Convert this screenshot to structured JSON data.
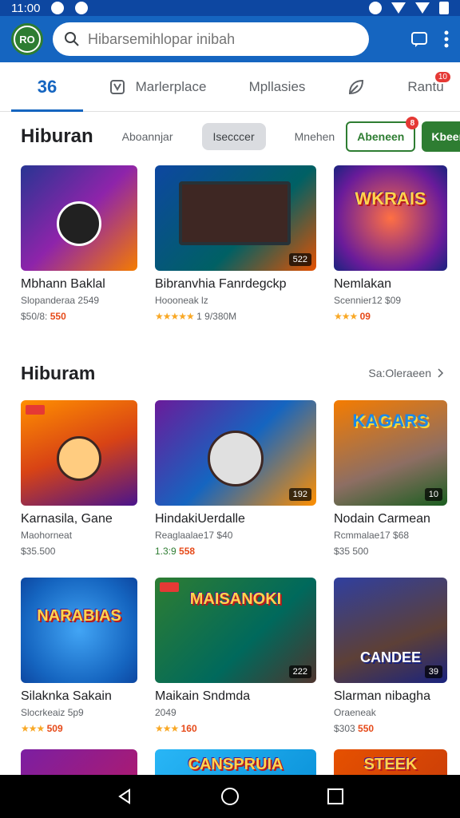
{
  "status_bar": {
    "time": "11:00"
  },
  "app_bar": {
    "logo_text": "RO",
    "search_placeholder": "Hibarsemihlopar inibah"
  },
  "tabs": [
    {
      "label": "36"
    },
    {
      "label": "Marlerplace"
    },
    {
      "label": "Mpllasies"
    },
    {
      "label": ""
    },
    {
      "label": "Rantu",
      "badge": "10"
    }
  ],
  "filter": {
    "title": "Hiburan",
    "chips": [
      "Aboannjar",
      "Isecccer",
      "Mnehen"
    ],
    "outline_button": "Abeneen",
    "outline_badge": "8",
    "solid_button": "Kbeenee"
  },
  "section1": {
    "cards": [
      {
        "title": "Mbhann Baklal",
        "sub": "Slopanderaa 2549",
        "price": "550",
        "meta": "$50/8:",
        "thumb": ""
      },
      {
        "title": "Bibranvhia Fanrdegckp",
        "sub": "Hoooneak lz",
        "meta": "1 9/380M",
        "stars": "★★★★★",
        "count": "522",
        "thumb": ""
      },
      {
        "title": "Nemlakan",
        "sub": "Scennier12 $09",
        "meta": "09",
        "stars": "★★★",
        "thumb": "WKRAIS"
      }
    ]
  },
  "section2": {
    "title": "Hiburam",
    "see_all": "Sa:Oleraeen",
    "cards": [
      {
        "title": "Karnasila, Gane",
        "sub": "Maohorneat",
        "meta": "$35.500",
        "thumb": ""
      },
      {
        "title": "HindakiUerdalle",
        "sub": "Reaglaalae17 $40",
        "meta": "1.3:9",
        "price": "558",
        "count": "192",
        "thumb": ""
      },
      {
        "title": "Nodain Carmean",
        "sub": "Rcmmalae17 $68",
        "meta": "$35 500",
        "count": "10",
        "thumb": "KAGARS"
      }
    ]
  },
  "section3": {
    "cards": [
      {
        "title": "Silaknka Sakain",
        "sub": "Slocrkeaiz 5p9",
        "meta": "509",
        "stars": "★★★",
        "thumb": "NARABIAS"
      },
      {
        "title": "Maikain Sndmda",
        "sub": "2049",
        "meta": "160",
        "stars": "★★★",
        "count": "222",
        "thumb": "MAISANOKI"
      },
      {
        "title": "Slarman nibagha",
        "sub": "Oraeneak",
        "meta": "$303",
        "price": "550",
        "count": "39",
        "thumb": "CANDEE"
      }
    ]
  },
  "section4": {
    "cards": [
      {
        "thumb": ""
      },
      {
        "thumb": "CANSPRUIA"
      },
      {
        "thumb": "STEEK"
      }
    ]
  },
  "colors": {
    "primary": "#1565c0",
    "status_bar": "#0d47a1",
    "accent_green": "#2e7d32",
    "badge_red": "#e53935",
    "price_orange": "#e64a19"
  },
  "icons": [
    "search-icon",
    "chat-icon",
    "more-vert-icon",
    "grid-icon",
    "cup-icon",
    "leaf-icon",
    "chevron-right-icon",
    "back-icon",
    "home-icon",
    "recents-icon"
  ]
}
